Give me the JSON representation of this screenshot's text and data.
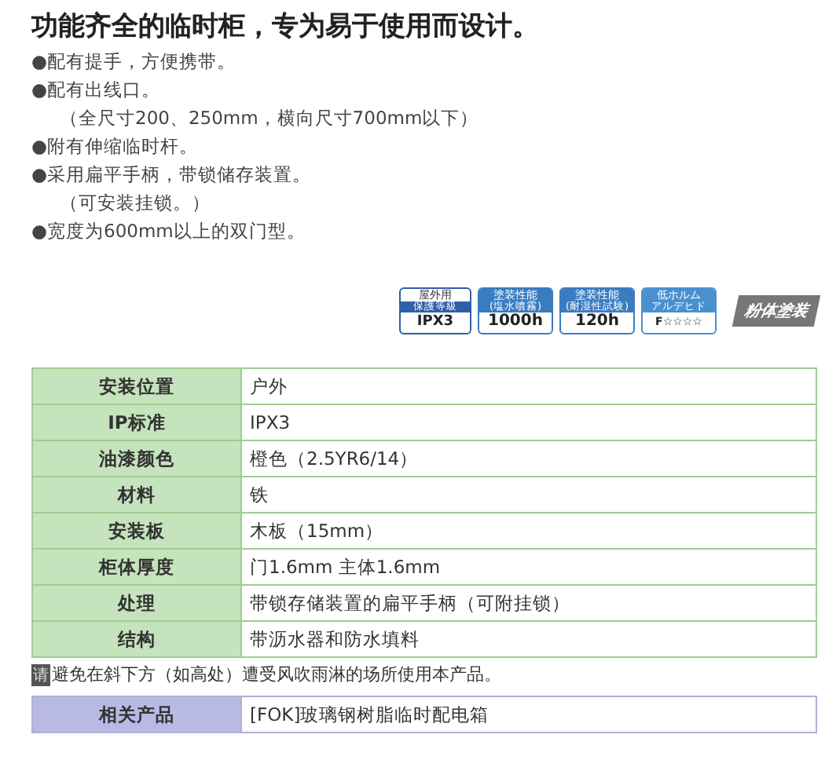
{
  "title": "功能齐全的临时柜，专为易于使用而设计。",
  "features": [
    {
      "text": "●配有提手，方便携带。",
      "kind": "bullet"
    },
    {
      "text": "●配有出线口。",
      "kind": "bullet"
    },
    {
      "text": "（全尺寸200、250mm，横向尺寸700mm以下）",
      "kind": "note"
    },
    {
      "text": "●附有伸缩临时杆。",
      "kind": "bullet"
    },
    {
      "text": "●采用扁平手柄，带锁储存装置。",
      "kind": "bullet"
    },
    {
      "text": "（可安装挂锁。）",
      "kind": "note"
    },
    {
      "text": "●宽度为600mm以上的双门型。",
      "kind": "bullet"
    }
  ],
  "badges": [
    {
      "kind": "rating",
      "top": "屋外用",
      "sub": "保護等級",
      "value": "IPX3"
    },
    {
      "kind": "performance",
      "top": "塗装性能",
      "sub": "(塩水噴霧)",
      "value": "1000h"
    },
    {
      "kind": "performance",
      "top": "塗装性能",
      "sub": "(耐湿性試験)",
      "value": "120h"
    },
    {
      "kind": "eco",
      "top": "低ホルム",
      "sub": "アルデヒド",
      "value": "F☆☆☆☆"
    },
    {
      "kind": "stamp",
      "value": "粉体塗装"
    }
  ],
  "spec_table": [
    {
      "label": "安装位置",
      "value": "户外"
    },
    {
      "label": "IP标准",
      "value": "IPX3"
    },
    {
      "label": "油漆颜色",
      "value": "橙色（2.5YR6/14）"
    },
    {
      "label": "材料",
      "value": "铁"
    },
    {
      "label": "安装板",
      "value": "木板（15mm）"
    },
    {
      "label": "柜体厚度",
      "value": "门1.6mm 主体1.6mm"
    },
    {
      "label": "处理",
      "value": "带锁存储装置的扁平手柄（可附挂锁）"
    },
    {
      "label": "结构",
      "value": "带沥水器和防水填料"
    }
  ],
  "notice": {
    "mark": "请",
    "text": "避免在斜下方（如高处）遭受风吹雨淋的场所使用本产品。"
  },
  "related": {
    "label": "相关产品",
    "value": "[FOK]玻璃钢树脂临时配电箱"
  }
}
